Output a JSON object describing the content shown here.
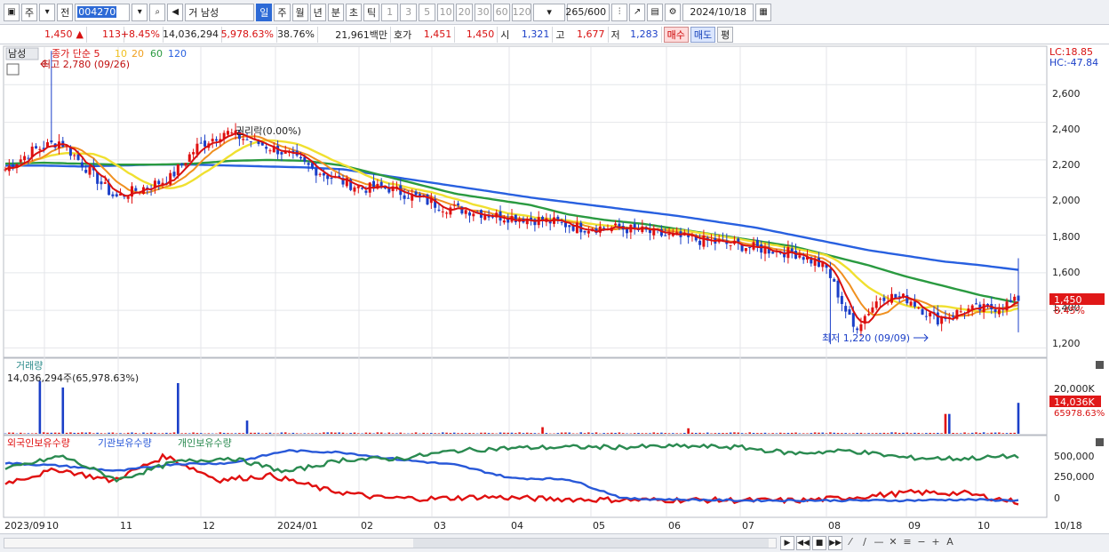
{
  "toolbar": {
    "market": "주",
    "prev": "전",
    "code": "004270",
    "sound_icon": "speaker-icon",
    "name": "거 남성",
    "periods": [
      "일",
      "주",
      "월",
      "년",
      "분",
      "초",
      "틱"
    ],
    "selected_period": "일",
    "minutes": [
      "1",
      "3",
      "5",
      "10",
      "20",
      "30",
      "60",
      "120"
    ],
    "count": "265",
    "count_max": "/600",
    "date": "2024/10/18"
  },
  "info": {
    "price": "1,450",
    "arrow": "▲",
    "change": "113",
    "change_pct": "+8.45%",
    "volume": "14,036,294",
    "vol_ratio": "5,978.63%",
    "turnover": "38.76%",
    "amount": "21,961백만",
    "ask_label": "호가",
    "ask": "1,451",
    "bid": "1,450",
    "open_label": "시",
    "open": "1,321",
    "high_label": "고",
    "high": "1,677",
    "low_label": "저",
    "low": "1,283",
    "buy": "매수",
    "sell": "매도",
    "flat": "평"
  },
  "price_panel": {
    "name_tag": "남성",
    "legend_prefix": "종가 단순 5",
    "ma": [
      {
        "label": "10",
        "color": "#f0c020"
      },
      {
        "label": "20",
        "color": "#f0a020"
      },
      {
        "label": "60",
        "color": "#2a9a40"
      },
      {
        "label": "120",
        "color": "#2860e0"
      }
    ],
    "max_note": "최고 2,780 (09/26)",
    "min_note": "최저 1,220 (09/09)",
    "ex_note": "권리락(0.00%)",
    "lc": "LC:18.85",
    "hc": "HC:-47.84",
    "current_price": "1,450",
    "current_pct": "8.45%",
    "y_ticks": [
      "2,600",
      "2,400",
      "2,200",
      "2,000",
      "1,800",
      "1,600",
      "1,400",
      "1,200"
    ]
  },
  "volume_panel": {
    "title": "거래량",
    "value": "14,036,294주(65,978.63%)",
    "y_ticks": [
      "20,000K",
      "10,000K"
    ],
    "current": "14,036K",
    "current_pct": "65978.63%"
  },
  "holding_panel": {
    "legend": [
      {
        "label": "외국인보유수량",
        "color": "#e01010"
      },
      {
        "label": "기관보유수량",
        "color": "#2858d8"
      },
      {
        "label": "개인보유수량",
        "color": "#2a8a50"
      }
    ],
    "y_ticks": [
      "500,000",
      "250,000",
      "0"
    ]
  },
  "x_axis": [
    "2023/09",
    "10",
    "11",
    "12",
    "2024/01",
    "02",
    "03",
    "04",
    "05",
    "06",
    "07",
    "08",
    "09",
    "10",
    "10/18"
  ],
  "chart_data": {
    "type": "candlestick",
    "ylim": [
      1150,
      2800
    ],
    "max": {
      "value": 2780,
      "date": "09/26"
    },
    "min": {
      "value": 1220,
      "date": "09/09"
    },
    "last_close": 1450,
    "ma120": [
      2170,
      2170,
      2165,
      2170,
      2175,
      2175,
      2170,
      2165,
      2160,
      2150,
      2120,
      2090,
      2060,
      2030,
      2000,
      1975,
      1950,
      1925,
      1900,
      1870,
      1840,
      1800,
      1760,
      1720,
      1690,
      1660,
      1640,
      1615
    ],
    "ma60": [
      2180,
      2185,
      2180,
      2175,
      2175,
      2180,
      2195,
      2200,
      2195,
      2170,
      2120,
      2070,
      2020,
      1990,
      1960,
      1910,
      1880,
      1860,
      1830,
      1800,
      1770,
      1740,
      1690,
      1640,
      1580,
      1530,
      1480,
      1440
    ],
    "closes": [
      2150,
      2250,
      2300,
      2150,
      2000,
      2050,
      2100,
      2270,
      2350,
      2300,
      2250,
      2170,
      2100,
      2050,
      2050,
      2000,
      1950,
      1930,
      1900,
      1890,
      1870,
      1840,
      1840,
      1830,
      1800,
      1780,
      1760,
      1740,
      1720,
      1700,
      1620,
      1300,
      1480,
      1460,
      1350,
      1400,
      1410,
      1450
    ]
  }
}
